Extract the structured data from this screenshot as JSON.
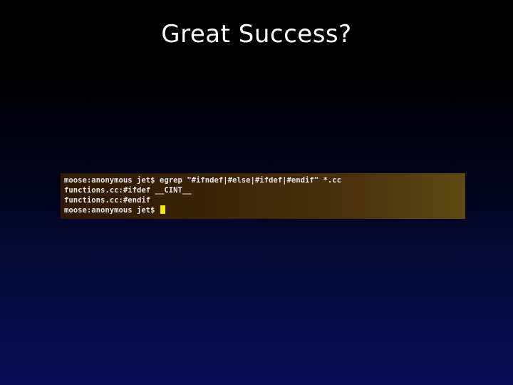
{
  "slide": {
    "title": "Great Success?"
  },
  "terminal": {
    "lines": [
      "moose:anonymous jet$ egrep \"#ifndef|#else|#ifdef|#endif\" *.cc",
      "functions.cc:#ifdef __CINT__",
      "functions.cc:#endif",
      "moose:anonymous jet$ "
    ]
  },
  "colors": {
    "cursor": "#f6e800",
    "text": "#e6e6ea",
    "title": "#ffffff"
  }
}
